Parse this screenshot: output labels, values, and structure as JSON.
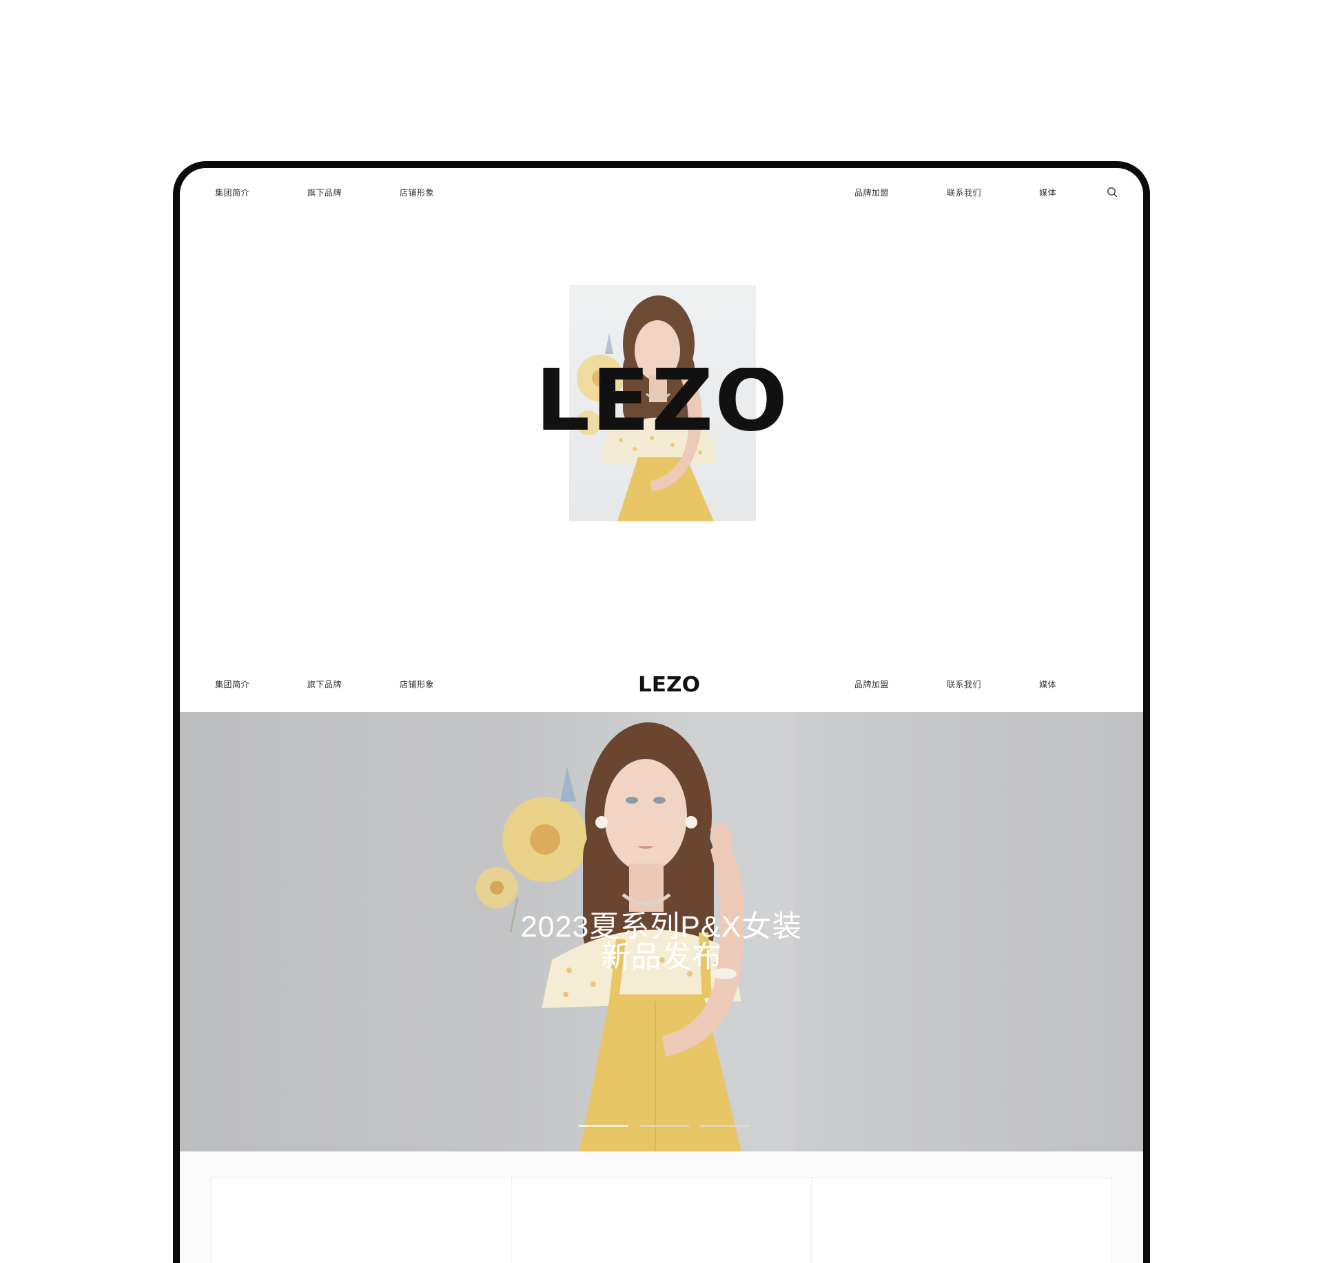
{
  "brand": {
    "logo_text": "LEZO"
  },
  "nav_top": {
    "left": [
      "集团简介",
      "旗下品牌",
      "店铺形象"
    ],
    "right": [
      "品牌加盟",
      "联系我们",
      "媒体"
    ]
  },
  "nav_second": {
    "left": [
      "集团简介",
      "旗下品牌",
      "店铺形象"
    ],
    "right": [
      "品牌加盟",
      "联系我们",
      "媒体"
    ]
  },
  "hero": {
    "title_line1": "2023夏系列P&X女装",
    "title_line2": "新品发布",
    "slides": [
      {
        "active": true
      },
      {
        "active": false
      },
      {
        "active": false
      }
    ]
  },
  "colors": {
    "frame": "#0b0b0b",
    "logo": "#111111",
    "dress_yellow": "#e8c665",
    "hero_bg": "#c4c5c7",
    "indicator_active": "#ffffff",
    "indicator_inactive": "#dcdcdc"
  },
  "icons": {
    "search": "search-icon"
  }
}
